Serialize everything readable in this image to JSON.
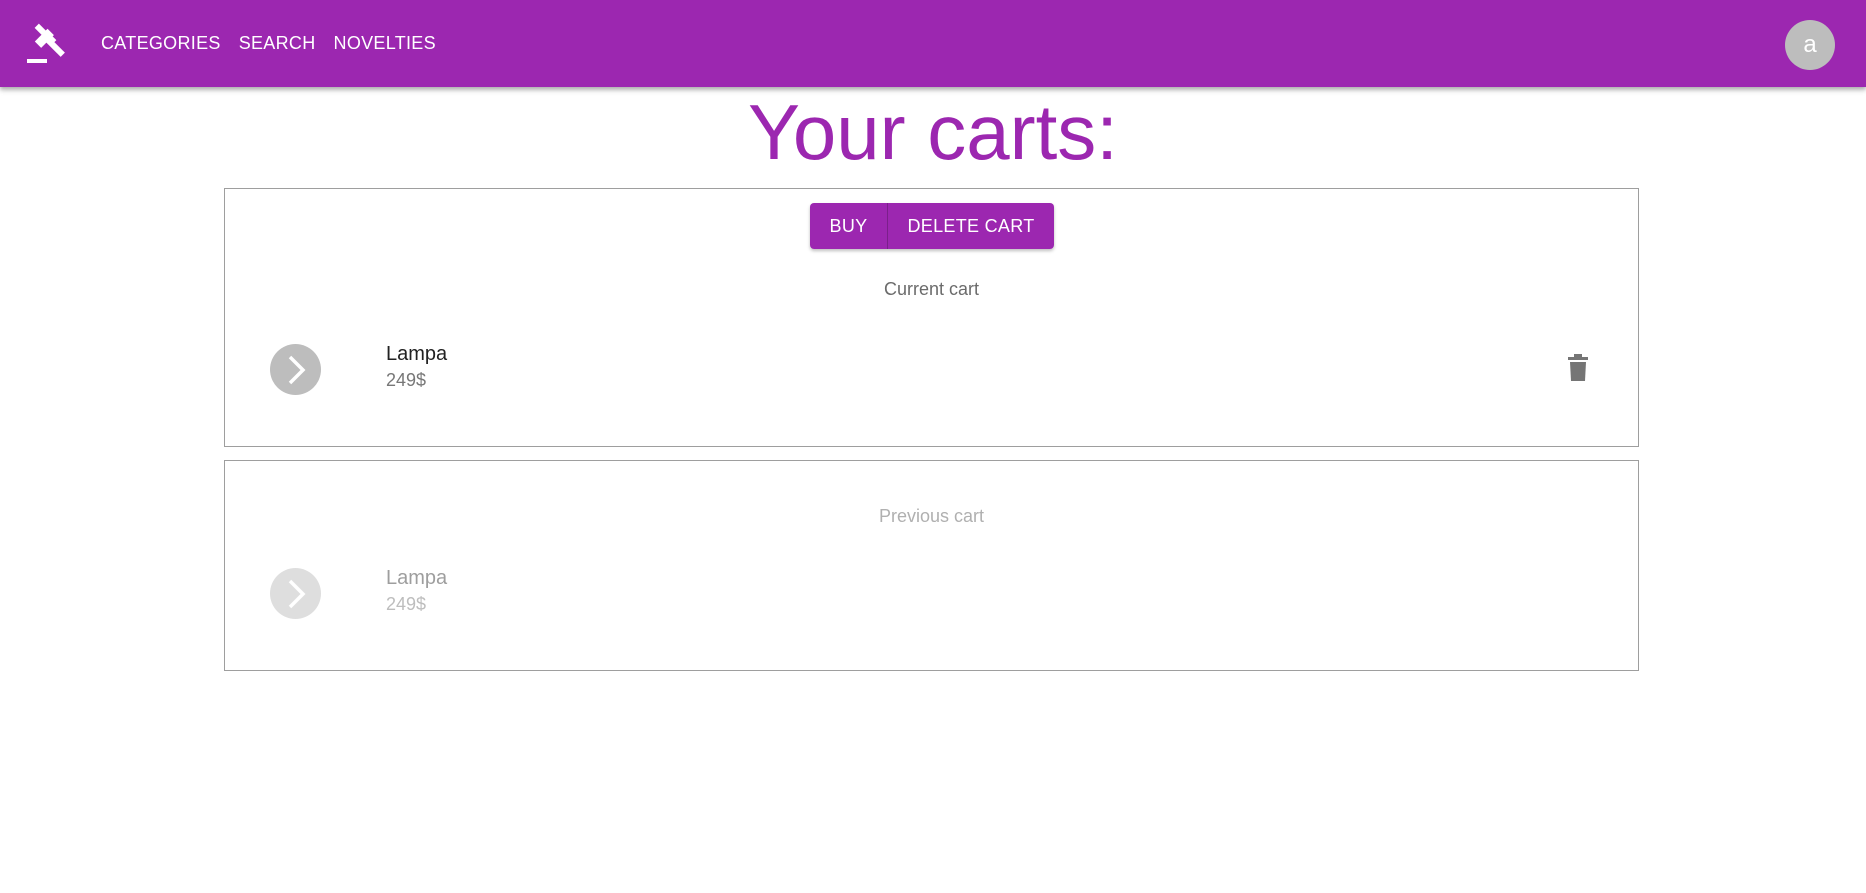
{
  "header": {
    "logo_icon": "gavel-icon",
    "nav": [
      "CATEGORIES",
      "SEARCH",
      "NOVELTIES"
    ],
    "avatar_letter": "a",
    "color": "#9c27b0"
  },
  "page": {
    "title": "Your carts:"
  },
  "current_cart": {
    "buy_label": "BUY",
    "delete_label": "DELETE CART",
    "label": "Current cart",
    "items": [
      {
        "name": "Lampa",
        "price": "249$",
        "icon": "chevron-right-icon",
        "action_icon": "trash-icon"
      }
    ]
  },
  "previous_cart": {
    "label": "Previous cart",
    "items": [
      {
        "name": "Lampa",
        "price": "249$",
        "icon": "chevron-right-icon"
      }
    ]
  }
}
